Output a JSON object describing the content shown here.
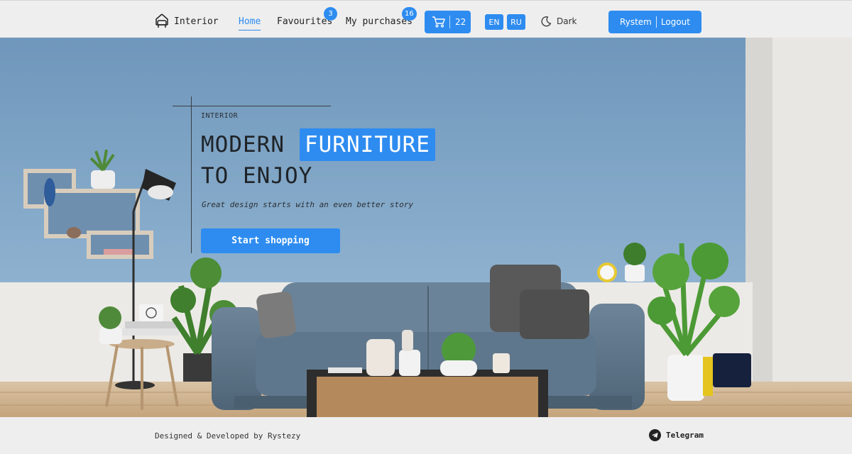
{
  "header": {
    "logo_text": "Interior",
    "nav": {
      "home": "Home",
      "favourites": "Favourites",
      "purchases": "My purchases"
    },
    "badges": {
      "favourites": "3",
      "purchases": "16"
    },
    "cart_count": "22",
    "languages": [
      "EN",
      "RU"
    ],
    "theme_label": "Dark",
    "user_name": "Rystem",
    "logout_label": "Logout",
    "accent_color": "#2e8cf0"
  },
  "hero": {
    "kicker": "INTERIOR",
    "line1_word": "MODERN",
    "line1_accent": "FURNITURE",
    "line2": "TO ENJOY",
    "subtitle": "Great design starts with an even better story",
    "cta_label": "Start shopping"
  },
  "footer": {
    "credit": "Designed & Developed by Rystezy",
    "telegram_label": "Telegram"
  }
}
